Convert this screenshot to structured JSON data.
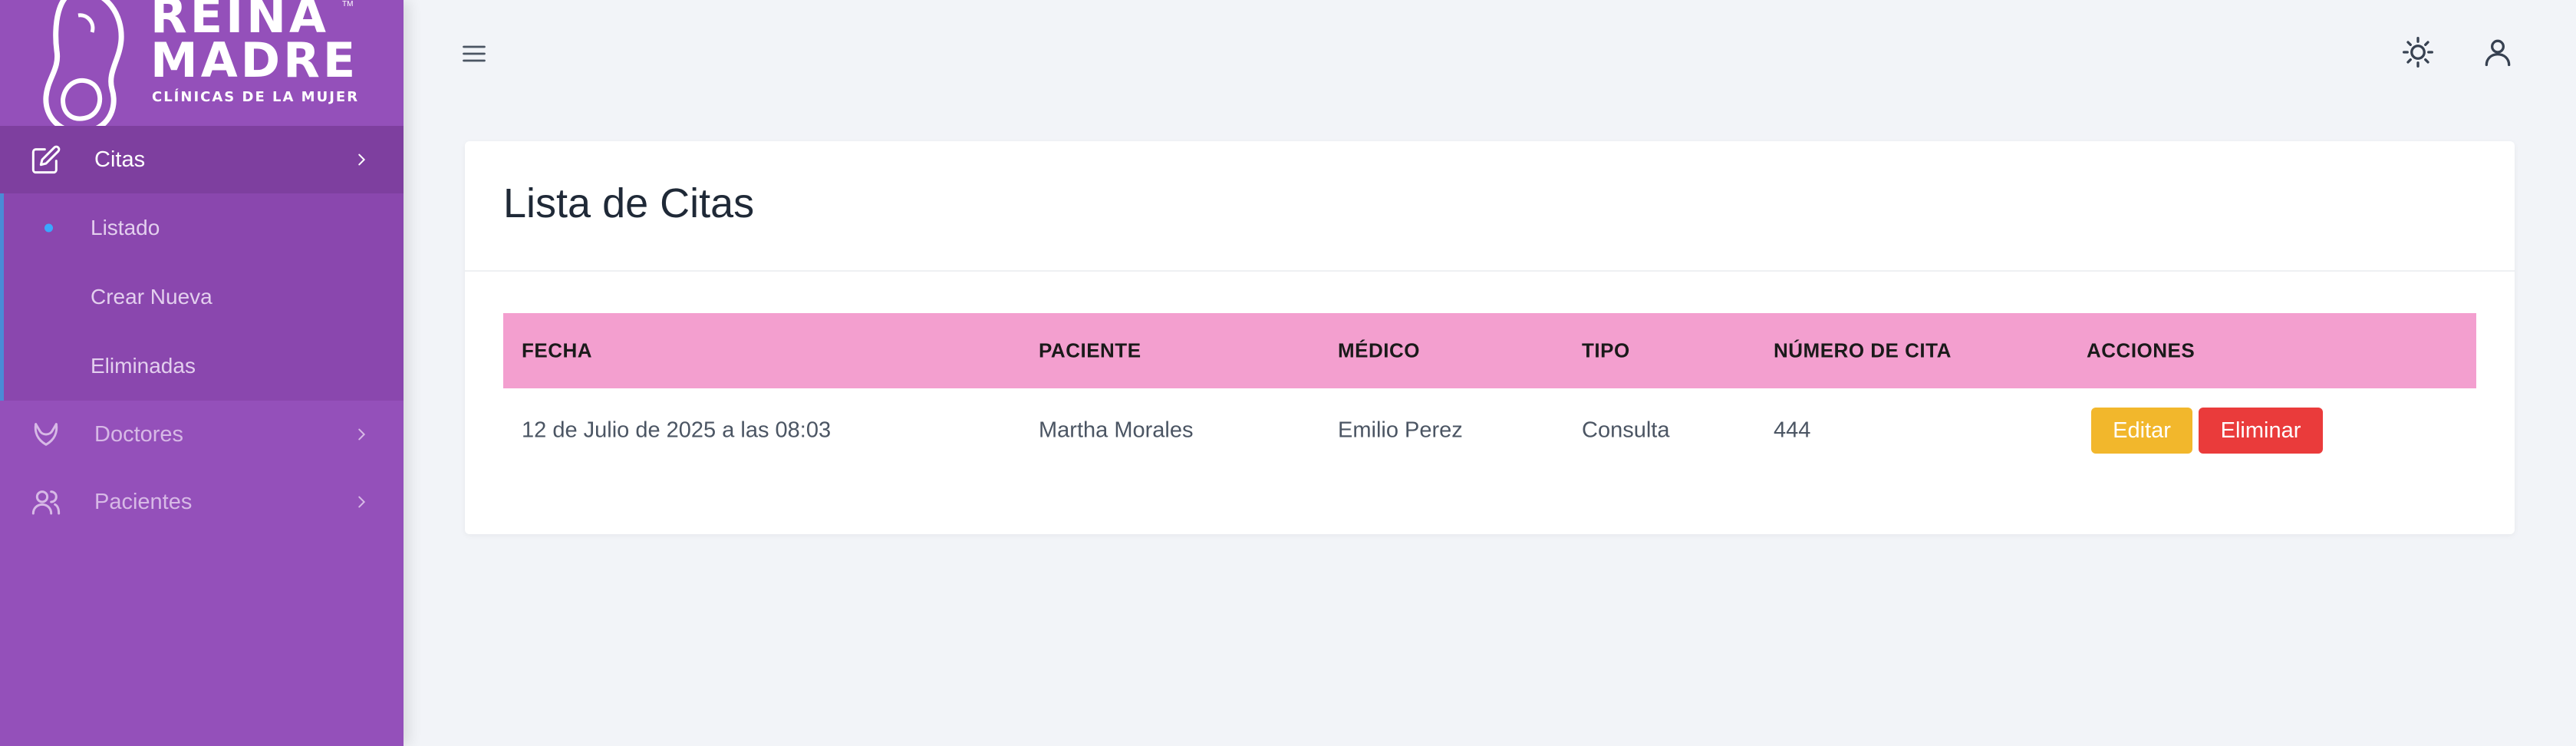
{
  "brand": {
    "line1": "REINA",
    "line2": "MADRE",
    "subtitle": "CLÍNICAS DE LA MUJER",
    "tm": "TM"
  },
  "sidebar": {
    "items": [
      {
        "label": "Citas",
        "icon": "edit-icon",
        "active": true
      },
      {
        "label": "Doctores",
        "icon": "stethoscope-icon"
      },
      {
        "label": "Pacientes",
        "icon": "users-icon"
      }
    ],
    "submenu": [
      {
        "label": "Listado",
        "active": true
      },
      {
        "label": "Crear Nueva"
      },
      {
        "label": "Eliminadas"
      }
    ]
  },
  "page": {
    "title": "Lista de Citas"
  },
  "table": {
    "headers": [
      "FECHA",
      "PACIENTE",
      "MÉDICO",
      "TIPO",
      "NÚMERO DE CITA",
      "ACCIONES"
    ],
    "rows": [
      {
        "fecha": "12 de Julio de 2025 a las 08:03",
        "paciente": "Martha Morales",
        "medico": "Emilio Perez",
        "tipo": "Consulta",
        "numero": "444",
        "edit_label": "Editar",
        "delete_label": "Eliminar"
      }
    ]
  },
  "colors": {
    "sidebar": "#9450ba",
    "header_row": "#f39fcf",
    "edit": "#f2b72c",
    "delete": "#ea3b3b"
  }
}
